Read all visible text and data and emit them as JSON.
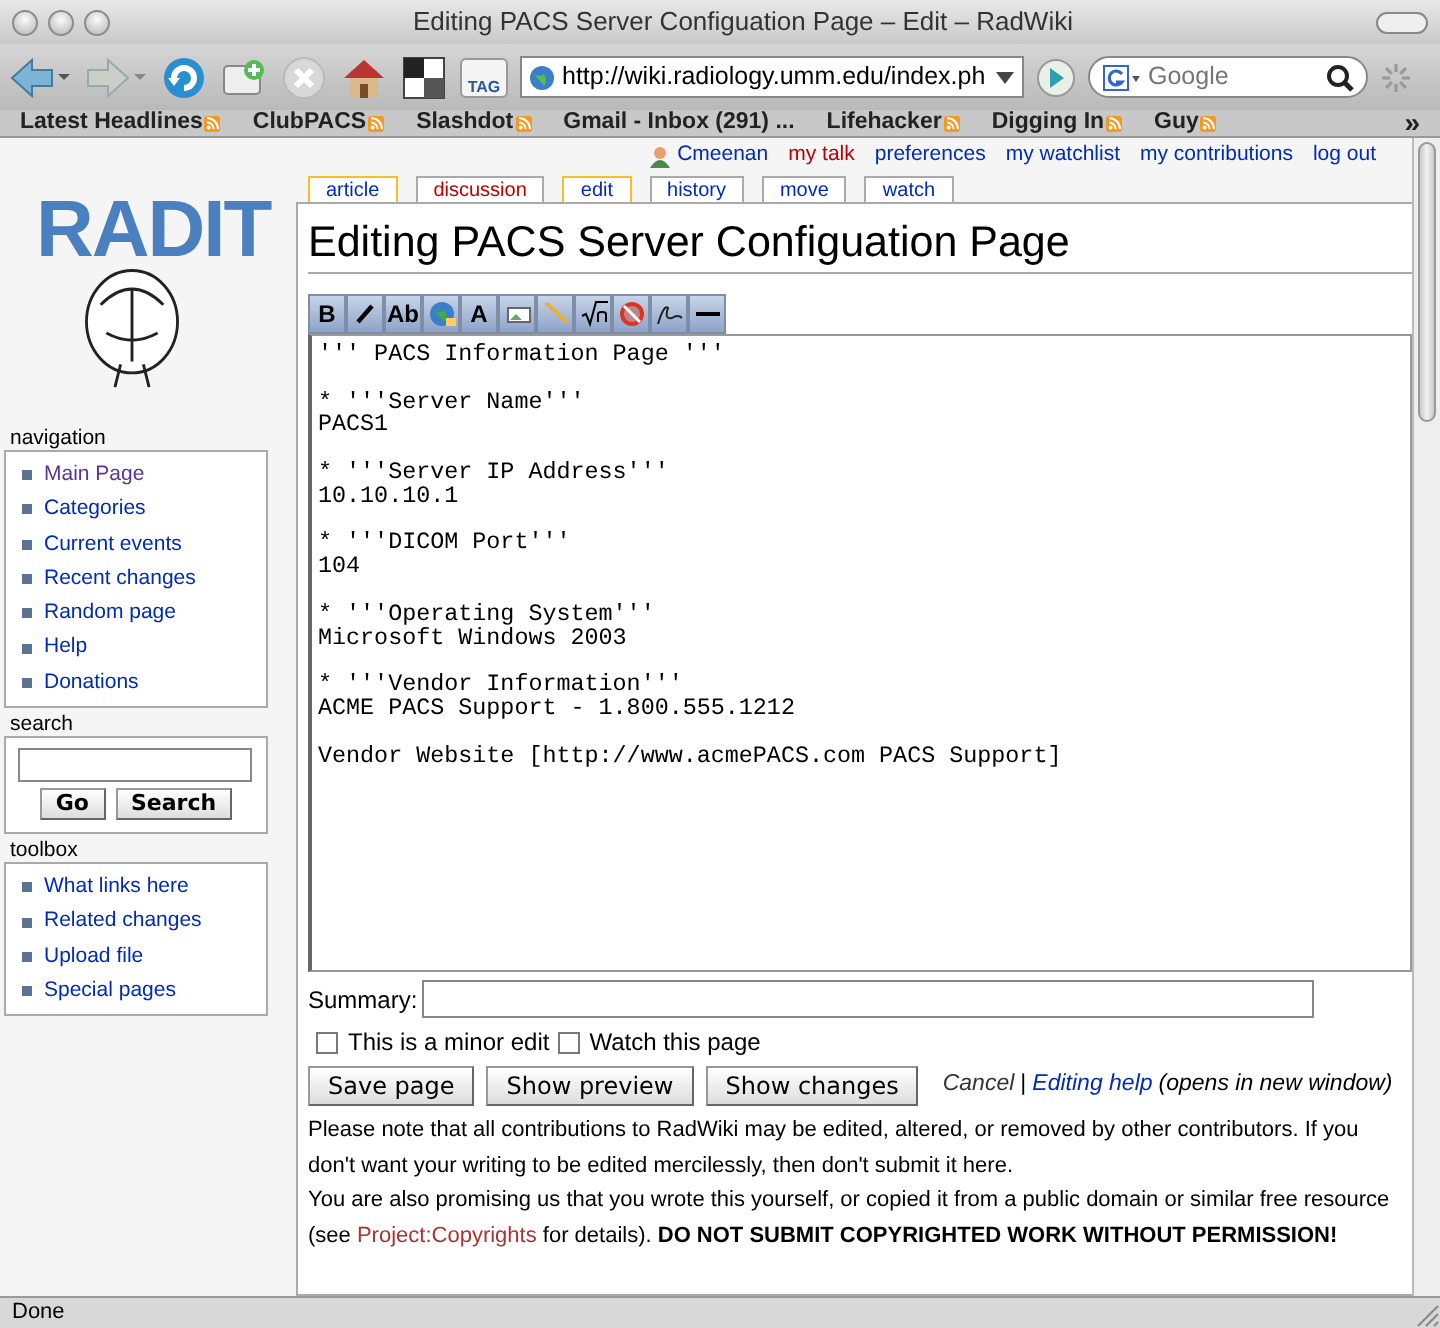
{
  "window": {
    "title": "Editing PACS Server Configuation Page – Edit – RadWiki"
  },
  "toolbar": {
    "url": "http://wiki.radiology.umm.edu/index.ph",
    "search_placeholder": "Google",
    "tag_label": "TAG"
  },
  "bookmarks": [
    {
      "label": "Latest Headlines",
      "feed": true
    },
    {
      "label": "ClubPACS",
      "feed": true
    },
    {
      "label": "Slashdot",
      "feed": true
    },
    {
      "label": "Gmail - Inbox (291) ...",
      "feed": false
    },
    {
      "label": "Lifehacker",
      "feed": true
    },
    {
      "label": "Digging In",
      "feed": true
    },
    {
      "label": "Guy",
      "feed": true
    }
  ],
  "bookmarks_more": "»",
  "user_links": [
    {
      "label": "Cmeenan",
      "kind": "user",
      "new": false
    },
    {
      "label": "my talk",
      "kind": "link",
      "new": true
    },
    {
      "label": "preferences",
      "kind": "link",
      "new": false
    },
    {
      "label": "my watchlist",
      "kind": "link",
      "new": false
    },
    {
      "label": "my contributions",
      "kind": "link",
      "new": false
    },
    {
      "label": "log out",
      "kind": "link",
      "new": false
    }
  ],
  "tabs": [
    {
      "label": "article",
      "selected": true,
      "new": false
    },
    {
      "label": "discussion",
      "selected": false,
      "new": true
    },
    {
      "label": "edit",
      "selected": true,
      "new": false
    },
    {
      "label": "history",
      "selected": false,
      "new": false
    },
    {
      "label": "move",
      "selected": false,
      "new": false
    },
    {
      "label": "watch",
      "selected": false,
      "new": false
    }
  ],
  "logo": {
    "text": "RADIT"
  },
  "heading": "Editing PACS Server Configuation Page",
  "editor_toolbar": [
    {
      "kind": "text",
      "label": "B"
    },
    {
      "kind": "italic"
    },
    {
      "kind": "text",
      "label": "Ab"
    },
    {
      "kind": "globe"
    },
    {
      "kind": "text",
      "label": "A"
    },
    {
      "kind": "image"
    },
    {
      "kind": "media"
    },
    {
      "kind": "math"
    },
    {
      "kind": "nowiki"
    },
    {
      "kind": "signature"
    },
    {
      "kind": "rule"
    }
  ],
  "editor": {
    "text": "''' PACS Information Page '''\n\n* '''Server Name'''\nPACS1\n\n* '''Server IP Address'''\n10.10.10.1\n\n* '''DICOM Port'''\n104\n\n* '''Operating System'''\nMicrosoft Windows 2003\n\n* '''Vendor Information'''\nACME PACS Support - 1.800.555.1212\n\nVendor Website [http://www.acmePACS.com PACS Support]"
  },
  "summary": {
    "label": "Summary:"
  },
  "checkboxes": [
    {
      "label": "This is a minor edit",
      "checked": false
    },
    {
      "label": "Watch this page",
      "checked": false
    }
  ],
  "buttons": [
    "Save page",
    "Show preview",
    "Show changes"
  ],
  "edit_links": {
    "cancel": "Cancel",
    "separator": "|",
    "help": "Editing help",
    "help_note": "(opens in new window)"
  },
  "notice": {
    "first": "Please note that all contributions to RadWiki may be edited, altered, or removed by other contributors. If you don't want your writing to be edited mercilessly, then don't submit it here.",
    "before": "You are also promising us that you wrote this yourself, or copied it from a public domain or similar free resource (see ",
    "link": "Project:Copyrights",
    "after": " for details). **DO NOT SUBMIT COPYRIGHTED WORK WITHOUT PERMISSION!**"
  },
  "sidebar": [
    {
      "title": "navigation",
      "kind": "links",
      "items": [
        {
          "label": "Main Page",
          "visited": true
        },
        {
          "label": "Categories",
          "visited": false
        },
        {
          "label": "Current events",
          "visited": false
        },
        {
          "label": "Recent changes",
          "visited": false
        },
        {
          "label": "Random page",
          "visited": false
        },
        {
          "label": "Help",
          "visited": false
        },
        {
          "label": "Donations",
          "visited": false
        }
      ]
    },
    {
      "title": "search",
      "kind": "search",
      "buttons": [
        "Go",
        "Search"
      ]
    },
    {
      "title": "toolbox",
      "kind": "links",
      "items": [
        {
          "label": "What links here",
          "visited": false
        },
        {
          "label": "Related changes",
          "visited": false
        },
        {
          "label": "Upload file",
          "visited": false
        },
        {
          "label": "Special pages",
          "visited": false
        }
      ]
    }
  ],
  "status_bar": {
    "text": "Done"
  }
}
